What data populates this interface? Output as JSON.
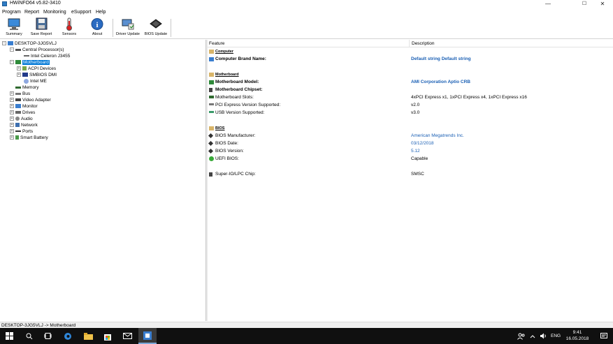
{
  "window": {
    "title": "HWiNFO64 v5.82-3410",
    "minimize_glyph": "—",
    "maximize_glyph": "☐",
    "close_glyph": "✕"
  },
  "menu": [
    "Program",
    "Report",
    "Monitoring",
    "eSupport",
    "Help"
  ],
  "toolbar": {
    "summary": "Summary",
    "save_report": "Save Report",
    "sensors": "Sensors",
    "about": "About",
    "driver_update": "Driver Update",
    "bios_update": "BIOS Update"
  },
  "tree": {
    "root": "DESKTOP-3JG5VLJ",
    "cpu": "Central Processor(s)",
    "cpu_child": "Intel Celeron J3455",
    "motherboard": "Motherboard",
    "acpi": "ACPI Devices",
    "smbios": "SMBIOS DMI",
    "intel_me": "Intel ME",
    "memory": "Memory",
    "bus": "Bus",
    "video": "Video Adapter",
    "monitor": "Monitor",
    "drives": "Drives",
    "audio": "Audio",
    "network": "Network",
    "ports": "Ports",
    "battery": "Smart Battery",
    "expand_glyph": "+",
    "collapse_glyph": "−"
  },
  "details": {
    "col_feature": "Feature",
    "col_description": "Description",
    "computer_section": "Computer",
    "brand_label": "Computer Brand Name:",
    "brand_value": "Default string Default string",
    "mb_section": "Motherboard",
    "mb_model_label": "Motherboard Model:",
    "mb_model_value": "AMI Corporation Aptio CRB",
    "mb_chipset_label": "Motherboard Chipset:",
    "mb_slots_label": "Motherboard Slots:",
    "mb_slots_value": "4xPCI Express x1, 1xPCI Express x4, 1xPCI Express x16",
    "pcie_label": "PCI Express Version Supported:",
    "pcie_value": "v2.0",
    "usb_label": "USB Version Supported:",
    "usb_value": "v3.0",
    "bios_section": "BIOS",
    "bios_mfr_label": "BIOS Manufacturer:",
    "bios_mfr_value": "American Megatrends Inc.",
    "bios_date_label": "BIOS Date:",
    "bios_date_value": "03/12/2018",
    "bios_ver_label": "BIOS Version:",
    "bios_ver_value": "5.12",
    "uefi_label": "UEFI BIOS:",
    "uefi_value": "Capable",
    "superio_label": "Super-IO/LPC Chip:",
    "superio_value": "SMSC"
  },
  "status": "DESKTOP-3JG5VLJ -> Motherboard",
  "taskbar": {
    "language": "ENG",
    "time": "9:41",
    "date": "16.05.2018"
  },
  "colors": {
    "accent": "#0078d7",
    "link_blue": "#1a5fb4",
    "taskbar": "#101010"
  }
}
